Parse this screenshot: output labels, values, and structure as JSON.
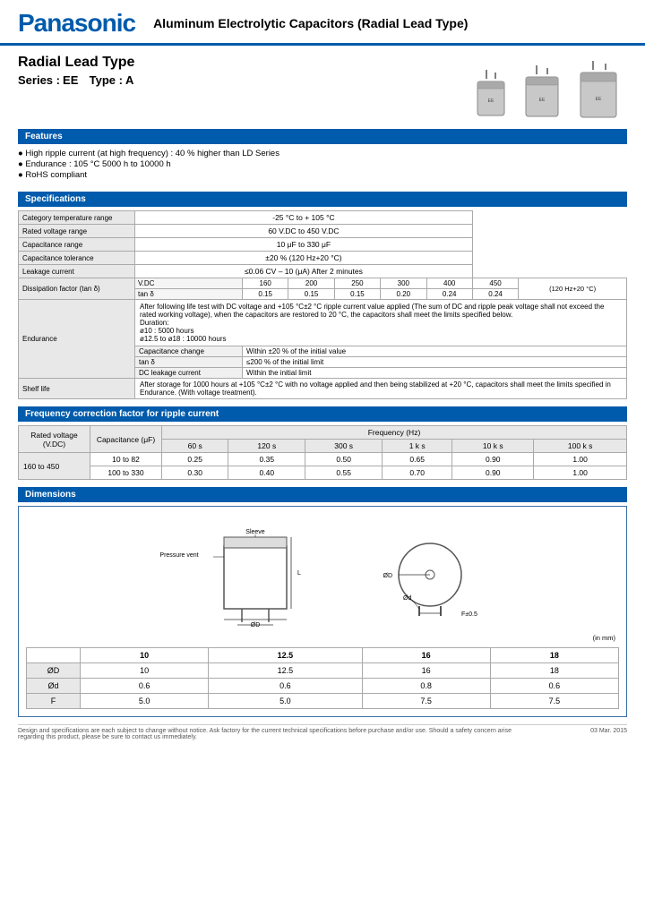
{
  "header": {
    "logo": "Panasonic",
    "title": "Aluminum Electrolytic Capacitors (Radial Lead Type)"
  },
  "product": {
    "type_label": "Radial Lead Type",
    "series_label": "Series :",
    "series_value": "EE",
    "type_word": "Type :",
    "type_value": "A"
  },
  "sections": {
    "features": {
      "title": "Features",
      "items": [
        "High ripple current (at high frequency) : 40 % higher than LD Series",
        "Endurance : 105 °C 5000 h to 10000 h",
        "RoHS compliant"
      ]
    },
    "specifications": {
      "title": "Specifications",
      "rows": [
        {
          "label": "Category temperature range",
          "value": "-25 °C to + 105 °C"
        },
        {
          "label": "Rated voltage range",
          "value": "60 V.DC to 450 V.DC"
        },
        {
          "label": "Capacitance range",
          "value": "10 μF to 330 μF"
        },
        {
          "label": "Capacitance tolerance",
          "value": "±20 % (120 Hz+20 °C)"
        },
        {
          "label": "Leakage current",
          "value": "≤0.06 CV – 10 (μA)  After 2 minutes"
        },
        {
          "label": "Dissipation factor (tan δ)",
          "value": ""
        },
        {
          "label": "Endurance",
          "value": ""
        },
        {
          "label": "Shelf life",
          "value": ""
        }
      ],
      "dissipation": {
        "row1_label": "V.DC",
        "col_headers": [
          "160",
          "200",
          "250",
          "300",
          "400",
          "450"
        ],
        "tan_values": [
          "0.15",
          "0.15",
          "0.15",
          "0.20",
          "0.24",
          "0.24"
        ],
        "note": "(120 Hz+20 °C)",
        "tan_label": "tan δ"
      },
      "endurance": {
        "intro": "After following life test with DC voltage and +105 °C±2 °C ripple current value applied (The sum of DC and ripple peak voltage shall not exceed the rated working voltage), when the capacitors are restored to 20 °C, the capacitors shall meet the limits specified below.",
        "duration_label": "Duration:",
        "durations": [
          "ø10 : 5000 hours",
          "ø12.5 to ø18 : 10000 hours"
        ],
        "sub_rows": [
          {
            "label": "Capacitance change",
            "value": "Within ±20 % of the initial value"
          },
          {
            "label": "tan δ",
            "value": "≤200 % of the initial limit"
          },
          {
            "label": "DC leakage current",
            "value": "Within the initial limit"
          }
        ]
      },
      "shelf_life": "After storage for 1000 hours at +105 °C±2 °C with no voltage applied and then being stabilized at +20 °C, capacitors shall meet the limits specified in Endurance. (With voltage treatment)."
    },
    "frequency": {
      "title": "Frequency correction factor for ripple current",
      "col_headers": [
        "Capacitance (μF)",
        "60 s",
        "120 s",
        "300 s",
        "1 k s",
        "10 k s",
        "100 k s"
      ],
      "voltage_label": "Rated voltage (V.DC)",
      "rows": [
        {
          "voltage": "160 to 450",
          "sub_rows": [
            {
              "cap": "10 to 82",
              "vals": [
                "0.25",
                "0.35",
                "0.50",
                "0.65",
                "0.90",
                "1.00"
              ]
            },
            {
              "cap": "100 to 330",
              "vals": [
                "0.30",
                "0.40",
                "0.55",
                "0.70",
                "0.90",
                "1.00"
              ]
            }
          ]
        }
      ]
    },
    "dimensions": {
      "title": "Dimensions",
      "note": "(in mm)",
      "table_headers": [
        "ØD",
        "10",
        "12.5",
        "16",
        "18"
      ],
      "rows": [
        {
          "label": "ØD",
          "values": [
            "10",
            "12.5",
            "16",
            "18"
          ]
        },
        {
          "label": "Ød",
          "values": [
            "0.6",
            "0.6",
            "0.8",
            "0.6"
          ]
        },
        {
          "label": "F",
          "values": [
            "5.0",
            "5.0",
            "7.5",
            "7.5"
          ]
        }
      ]
    }
  },
  "footer": {
    "left": "Design and specifications are each subject to change without notice. Ask factory for the current technical specifications before purchase and/or use. Should a safety concern arise regarding this product, please be sure to contact us immediately.",
    "right": "03  Mar. 2015"
  }
}
